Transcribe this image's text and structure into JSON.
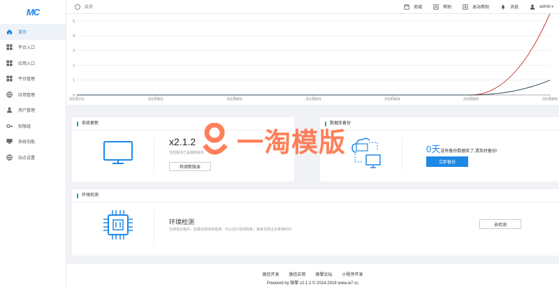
{
  "app": {
    "logo": "MC"
  },
  "sidebar": {
    "items": [
      {
        "label": "首页",
        "icon": "home-icon",
        "active": true
      },
      {
        "label": "平台入口",
        "icon": "grid-icon"
      },
      {
        "label": "应用入口",
        "icon": "grid-icon"
      },
      {
        "label": "平台管理",
        "icon": "grid-icon"
      },
      {
        "label": "应用管理",
        "icon": "globe-icon"
      },
      {
        "label": "用户管理",
        "icon": "user-icon"
      },
      {
        "label": "权限组",
        "icon": "key-icon"
      },
      {
        "label": "系统功能",
        "icon": "monitor-icon"
      },
      {
        "label": "站点设置",
        "icon": "globe-icon"
      }
    ]
  },
  "header": {
    "menu_label": "菜单",
    "items": [
      {
        "label": "商城",
        "icon": "store-icon"
      },
      {
        "label": "帮助",
        "icon": "help-icon"
      },
      {
        "label": "本站帮助",
        "icon": "help-icon"
      },
      {
        "label": "消息",
        "icon": "bell-icon"
      }
    ],
    "user": "admin"
  },
  "chart_data": {
    "type": "line",
    "categories": [
      "20190731",
      "20190801",
      "20190802",
      "20190803",
      "20190804",
      "20190805",
      "20190806"
    ],
    "ylim": [
      0,
      5
    ],
    "yticks": [
      "0",
      "1",
      "2",
      "3",
      "4",
      "5"
    ],
    "grid": true,
    "series": [
      {
        "values": [
          0,
          0,
          0,
          0,
          0,
          0,
          5.5
        ],
        "color": "#c23531"
      },
      {
        "values": [
          0,
          0,
          0,
          0,
          0,
          0,
          1
        ],
        "color": "#2f4554"
      }
    ]
  },
  "system_update": {
    "title": "系统更新",
    "version": "x2.1.2",
    "subtitle": "当前版本已是最新版本",
    "button": "检测新版本"
  },
  "backup": {
    "title": "数据库备份",
    "days": "0天",
    "text": "没有备份数据库了,请及时备份!",
    "button": "立即备份"
  },
  "env": {
    "title": "环境检测",
    "heading": "环境检测",
    "desc": "在使用过程中，如果出现未知错误，可以自行检测修复，避免花费过多等待时间",
    "button": "去检测"
  },
  "footer": {
    "links": [
      "微信开发",
      "微信应用",
      "微擎论坛",
      "小程序开发"
    ],
    "copyright": "Powered by 微擎 v2.1.2 © 2014-2018 www.w7.cc"
  },
  "watermark": {
    "text": "一淘模版"
  }
}
